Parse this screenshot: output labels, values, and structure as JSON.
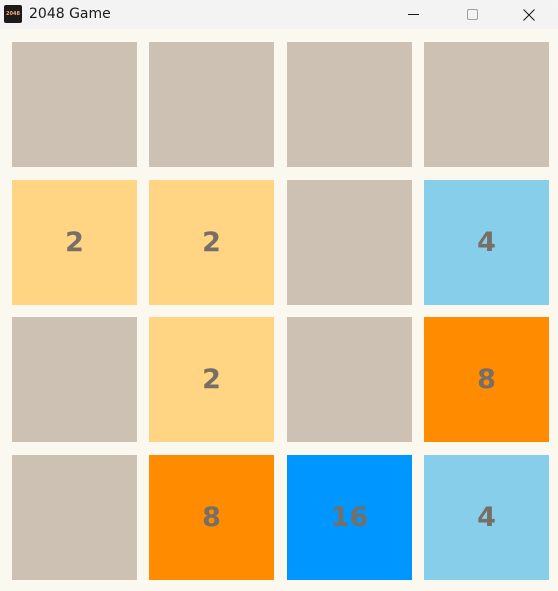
{
  "window": {
    "title": "2048 Game",
    "icon_text": "2048"
  },
  "colors": {
    "background": "#faf8ef",
    "empty": "#cdc1b4",
    "tile_2": "#ffd584",
    "tile_4": "#87ceeb",
    "tile_8": "#ff8c00",
    "tile_16": "#0096ff",
    "text": "#776e65"
  },
  "icons": {
    "minimize": "minimize-icon",
    "maximize": "maximize-icon",
    "close": "close-icon"
  },
  "board": [
    [
      "",
      "",
      "",
      ""
    ],
    [
      "2",
      "2",
      "",
      "4"
    ],
    [
      "",
      "2",
      "",
      "8"
    ],
    [
      "",
      "8",
      "16",
      "4"
    ]
  ]
}
